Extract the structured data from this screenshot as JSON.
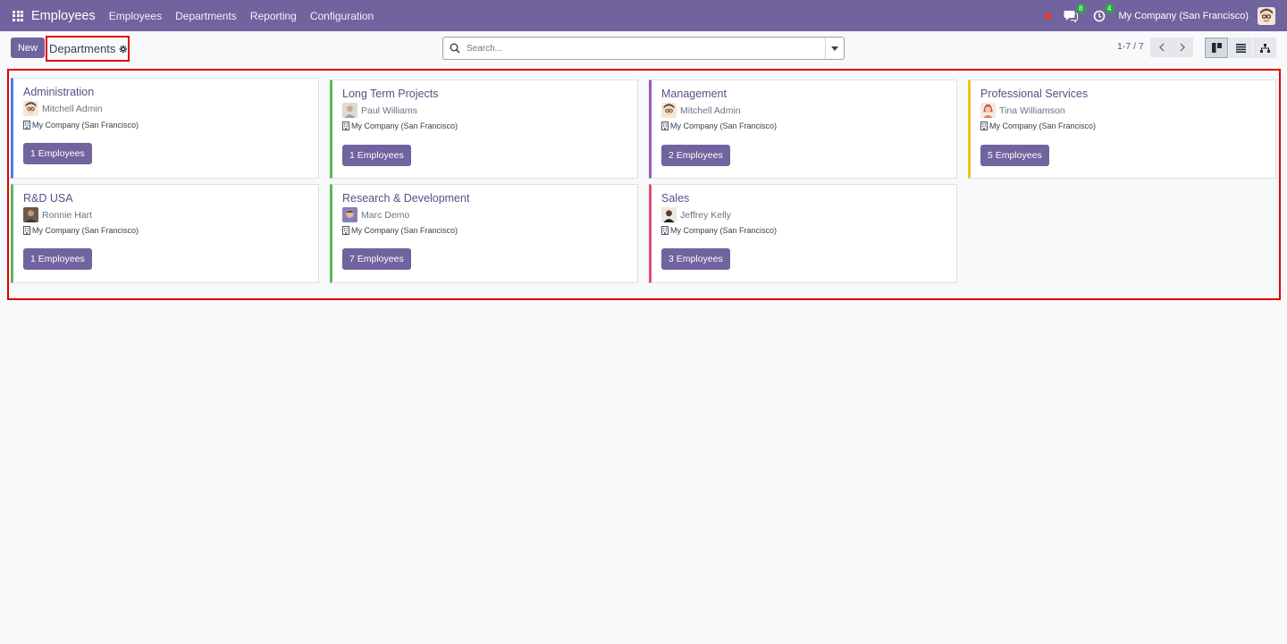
{
  "navbar": {
    "app_name": "Employees",
    "menu": [
      "Employees",
      "Departments",
      "Reporting",
      "Configuration"
    ],
    "messages_count": "8",
    "activities_count": "4",
    "company": "My Company (San Francisco)",
    "color": "#71639e"
  },
  "control_panel": {
    "new_label": "New",
    "breadcrumb_title": "Departments",
    "search_placeholder": "Search...",
    "pager": "1-7 / 7"
  },
  "departments": [
    {
      "name": "Administration",
      "manager": "Mitchell Admin",
      "company": "My Company (San Francisco)",
      "employees": "1 Employees",
      "color": "#4c7ee8",
      "avatar": "mitchell"
    },
    {
      "name": "Long Term Projects",
      "manager": "Paul Williams",
      "company": "My Company (San Francisco)",
      "employees": "1 Employees",
      "color": "#5cb85c",
      "avatar": "paul"
    },
    {
      "name": "Management",
      "manager": "Mitchell Admin",
      "company": "My Company (San Francisco)",
      "employees": "2 Employees",
      "color": "#9b59b6",
      "avatar": "mitchell"
    },
    {
      "name": "Professional Services",
      "manager": "Tina Williamson",
      "company": "My Company (San Francisco)",
      "employees": "5 Employees",
      "color": "#f0c419",
      "avatar": "tina"
    },
    {
      "name": "R&D USA",
      "manager": "Ronnie Hart",
      "company": "My Company (San Francisco)",
      "employees": "1 Employees",
      "color": "#5cb85c",
      "avatar": "ronnie"
    },
    {
      "name": "Research & Development",
      "manager": "Marc Demo",
      "company": "My Company (San Francisco)",
      "employees": "7 Employees",
      "color": "#5cb85c",
      "avatar": "marc"
    },
    {
      "name": "Sales",
      "manager": "Jeffrey Kelly",
      "company": "My Company (San Francisco)",
      "employees": "3 Employees",
      "color": "#e0506e",
      "avatar": "jeffrey"
    }
  ]
}
